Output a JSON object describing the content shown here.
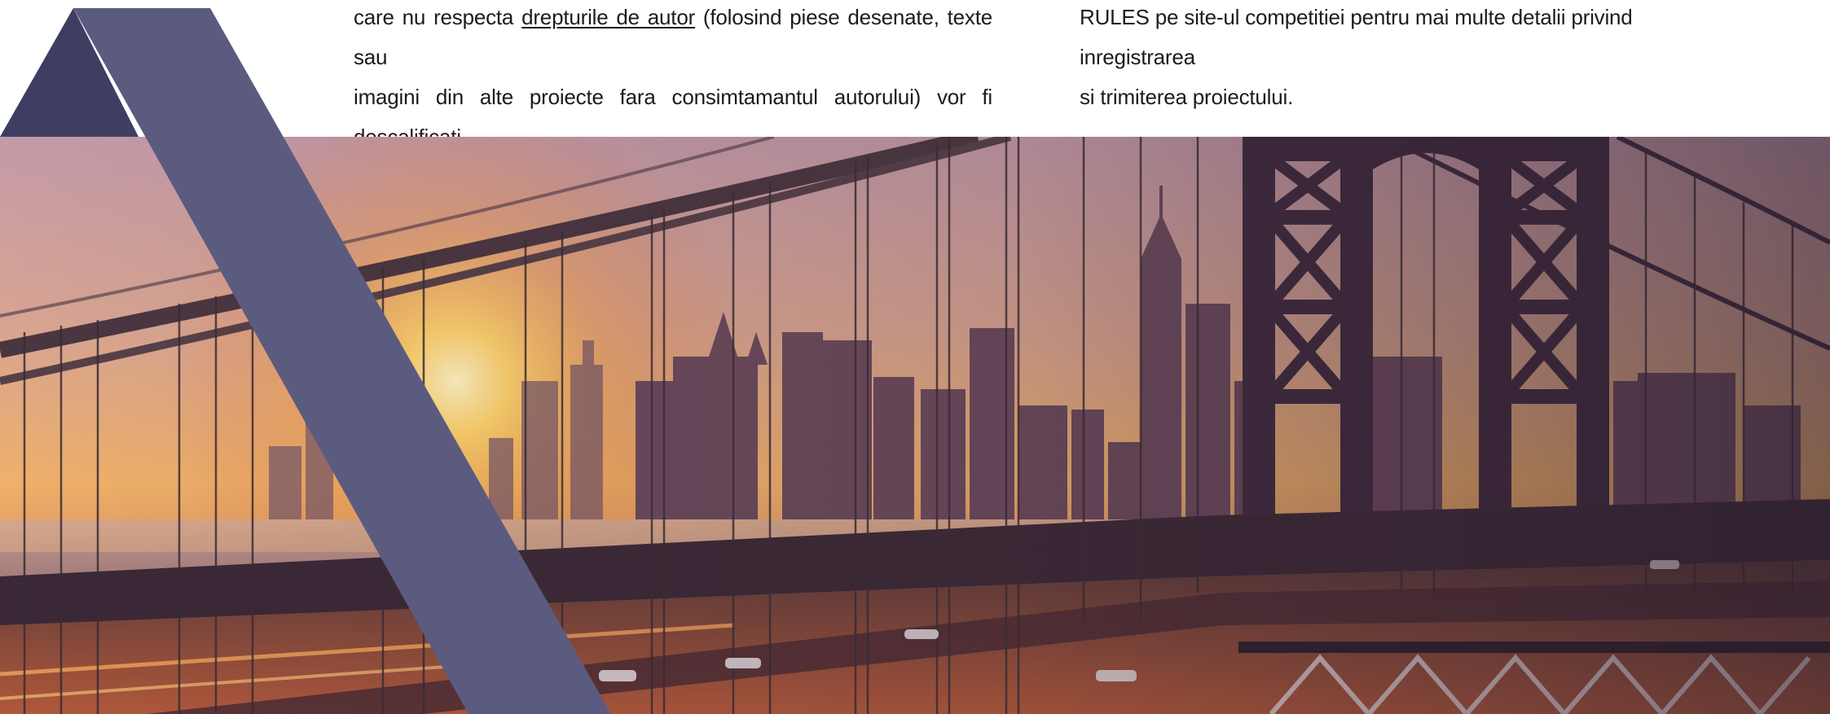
{
  "text": {
    "left_column": {
      "line1_before": "care nu respecta ",
      "line1_link": "drepturile de autor",
      "line1_after": " (folosind piese desenate, texte sau",
      "line2": "imagini din alte proiecte fara consimtamantul autorului) vor fi descalificati."
    },
    "right_column": {
      "line1": "RULES pe site-ul competitiei pentru mai multe detalii privind inregistrarea",
      "line2": "si trimiterea proiectului."
    }
  },
  "colors": {
    "ribbon": "#5b5b80",
    "ribbon_dark": "#3e3e62",
    "sky_top": "#c59aa6",
    "sky_glow": "#f7b84a",
    "bridge": "#3a2a3a"
  }
}
